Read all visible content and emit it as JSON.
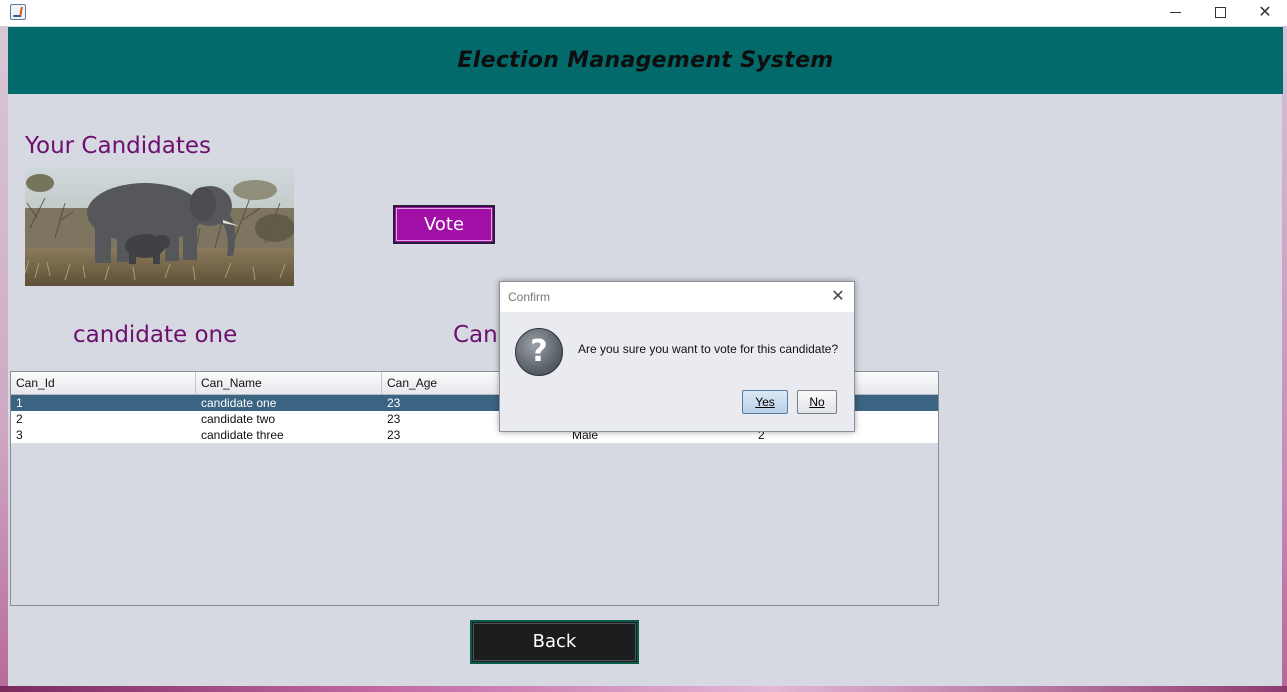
{
  "window": {
    "controls": {
      "minimize": "minimize",
      "maximize": "maximize",
      "close": "✕"
    }
  },
  "header": {
    "title": "Election Management System"
  },
  "main": {
    "section_title": "Your Candidates",
    "vote_label": "Vote",
    "candidate_left": "candidate one",
    "candidate_right": "Canc",
    "back_label": "Back"
  },
  "table": {
    "columns": [
      "Can_Id",
      "Can_Name",
      "Can_Age",
      "",
      ""
    ],
    "rows": [
      {
        "id": "1",
        "name": "candidate one",
        "age": "23",
        "col4": "",
        "col5": "",
        "selected": true
      },
      {
        "id": "2",
        "name": "candidate two",
        "age": "23",
        "col4": "",
        "col5": "",
        "selected": false
      },
      {
        "id": "3",
        "name": "candidate three",
        "age": "23",
        "col4": "Male",
        "col5": "2",
        "selected": false
      }
    ]
  },
  "dialog": {
    "title": "Confirm",
    "message": "Are you sure you want to vote for this candidate?",
    "yes_label": "Yes",
    "no_label": "No",
    "close_glyph": "✕",
    "icon_glyph": "?"
  },
  "colors": {
    "header_bg": "#036a6b",
    "accent_purple": "#a010a6",
    "label_purple": "#6c0f6e",
    "selection": "#3a6482"
  }
}
